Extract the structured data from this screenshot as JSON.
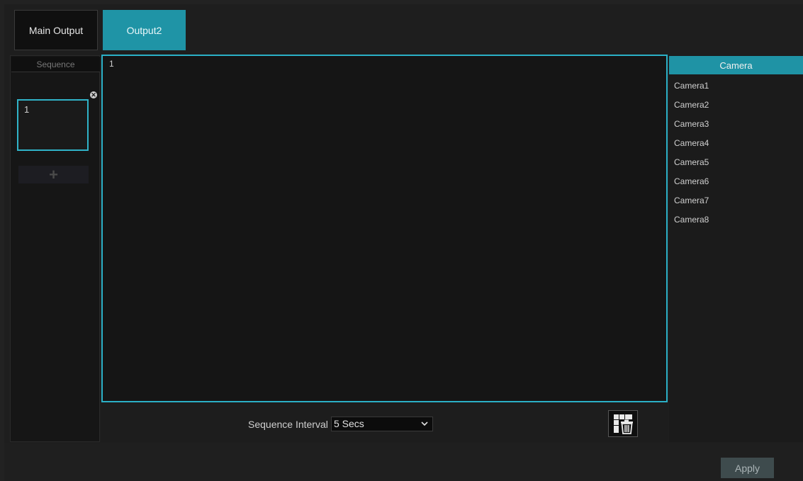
{
  "tabs": [
    {
      "label": "Main Output"
    },
    {
      "label": "Output2"
    }
  ],
  "sequence": {
    "header": "Sequence",
    "items": [
      {
        "label": "1"
      }
    ],
    "add_label": "+"
  },
  "preview": {
    "window_number": "1"
  },
  "bottom": {
    "interval_label": "Sequence Interval",
    "interval_value": "5 Secs"
  },
  "camera_panel": {
    "header": "Camera",
    "cameras": [
      "Camera1",
      "Camera2",
      "Camera3",
      "Camera4",
      "Camera5",
      "Camera6",
      "Camera7",
      "Camera8"
    ]
  },
  "footer": {
    "apply_label": "Apply"
  },
  "colors": {
    "accent": "#1f94a6",
    "border_highlight": "#2bb0c6"
  }
}
